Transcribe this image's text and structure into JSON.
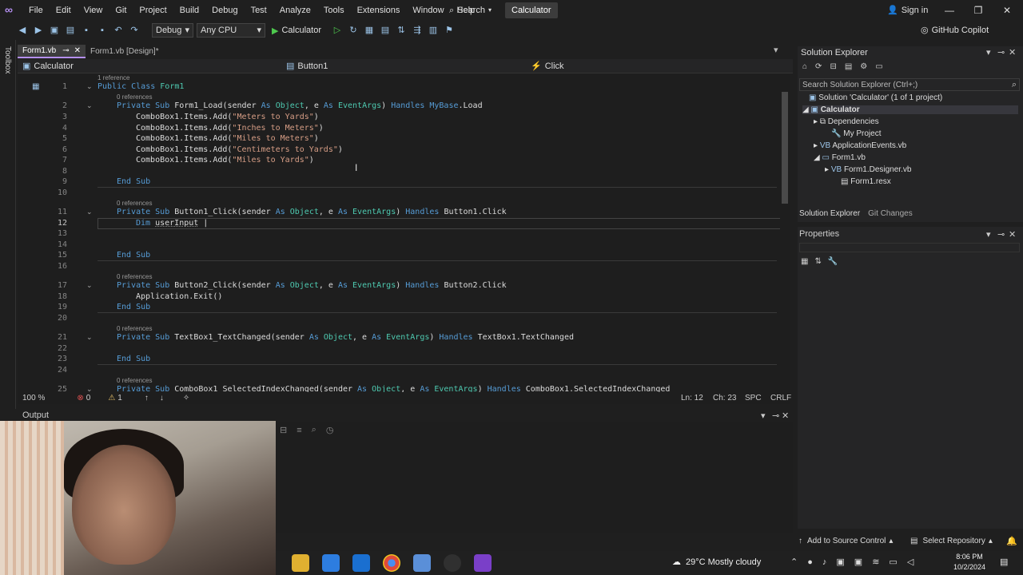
{
  "menu": [
    "File",
    "Edit",
    "View",
    "Git",
    "Project",
    "Build",
    "Debug",
    "Test",
    "Analyze",
    "Tools",
    "Extensions",
    "Window",
    "Help"
  ],
  "search_label": "Search",
  "app_title": "Calculator",
  "sign_in": "Sign in",
  "toolbar": {
    "config": "Debug",
    "platform": "Any CPU",
    "run_target": "Calculator",
    "copilot": "GitHub Copilot"
  },
  "toolbox_label": "Toolbox",
  "tabs": [
    "Form1.vb",
    "Form1.vb [Design]*"
  ],
  "navbar": {
    "project": "Calculator",
    "object": "Button1",
    "event": "Click"
  },
  "code": {
    "refs": {
      "r1": "1 reference",
      "r0": "0 references"
    },
    "lines": [
      {
        "n": "1",
        "text": "Public Class Form1"
      },
      {
        "n": "2",
        "text": "Private Sub Form1_Load(sender As Object, e As EventArgs) Handles MyBase.Load"
      },
      {
        "n": "3",
        "text": "ComboBox1.Items.Add(\"Meters to Yards\")"
      },
      {
        "n": "4",
        "text": "ComboBox1.Items.Add(\"Inches to Meters\")"
      },
      {
        "n": "5",
        "text": "ComboBox1.Items.Add(\"Miles to Meters\")"
      },
      {
        "n": "6",
        "text": "ComboBox1.Items.Add(\"Centimeters to Yards\")"
      },
      {
        "n": "7",
        "text": "ComboBox1.Items.Add(\"Miles to Yards\")"
      },
      {
        "n": "8",
        "text": ""
      },
      {
        "n": "9",
        "text": "End Sub"
      },
      {
        "n": "10",
        "text": ""
      },
      {
        "n": "11",
        "text": "Private Sub Button1_Click(sender As Object, e As EventArgs) Handles Button1.Click"
      },
      {
        "n": "12",
        "text": "Dim userInput"
      },
      {
        "n": "13",
        "text": ""
      },
      {
        "n": "14",
        "text": ""
      },
      {
        "n": "15",
        "text": "End Sub"
      },
      {
        "n": "16",
        "text": ""
      },
      {
        "n": "17",
        "text": "Private Sub Button2_Click(sender As Object, e As EventArgs) Handles Button2.Click"
      },
      {
        "n": "18",
        "text": "Application.Exit()"
      },
      {
        "n": "19",
        "text": "End Sub"
      },
      {
        "n": "20",
        "text": ""
      },
      {
        "n": "21",
        "text": "Private Sub TextBox1_TextChanged(sender As Object, e As EventArgs) Handles TextBox1.TextChanged"
      },
      {
        "n": "22",
        "text": ""
      },
      {
        "n": "23",
        "text": "End Sub"
      },
      {
        "n": "24",
        "text": ""
      },
      {
        "n": "25",
        "text": "Private Sub ComboBox1_SelectedIndexChanged(sender As Object, e As EventArgs) Handles ComboBox1.SelectedIndexChanged"
      }
    ]
  },
  "status": {
    "zoom": "100 %",
    "errors": "0",
    "warnings": "1",
    "line": "Ln: 12",
    "col": "Ch: 23",
    "spc": "SPC",
    "eol": "CRLF"
  },
  "output_title": "Output",
  "solution_explorer": {
    "title": "Solution Explorer",
    "search_placeholder": "Search Solution Explorer (Ctrl+;)",
    "items": [
      "Solution 'Calculator' (1 of 1 project)",
      "Calculator",
      "Dependencies",
      "My Project",
      "ApplicationEvents.vb",
      "Form1.vb",
      "Form1.Designer.vb",
      "Form1.resx"
    ],
    "tabs": [
      "Solution Explorer",
      "Git Changes"
    ]
  },
  "properties_title": "Properties",
  "bottom_bar": {
    "source_control": "Add to Source Control",
    "repo": "Select Repository"
  },
  "taskbar": {
    "weather": "29°C  Mostly cloudy",
    "time": "8:06 PM",
    "date": "10/2/2024"
  }
}
